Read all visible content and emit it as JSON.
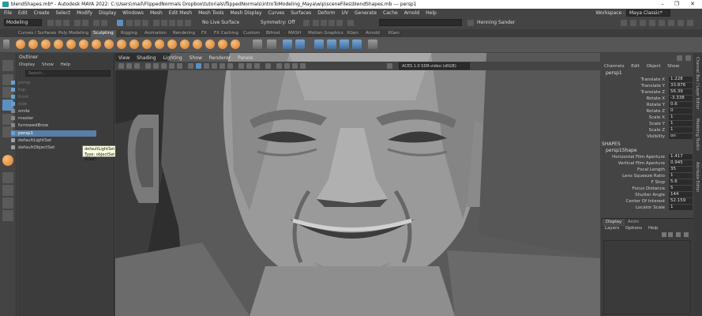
{
  "window": {
    "title": "blendShapes.mb* - Autodesk MAYA 2022: C:\\Users\\mail\\FlippedNormals Dropbox\\tutorials\\flippedNormals\\introToModeling_Maya\\wip\\sceneFiles\\blendShapes.mb  ---  persp1",
    "min": "–",
    "max": "❐",
    "close": "✕"
  },
  "menubar": {
    "items": [
      "File",
      "Edit",
      "Create",
      "Select",
      "Modify",
      "Display",
      "Windows",
      "Mesh",
      "Edit Mesh",
      "Mesh Tools",
      "Mesh Display",
      "Curves",
      "Surfaces",
      "Deform",
      "UV",
      "Generate",
      "Cache",
      "Arnold",
      "Help"
    ],
    "workspace_label": "Workspace :",
    "workspace_value": "Maya Classic*"
  },
  "statusline": {
    "mode": "Modeling",
    "live_surface": "No Live Surface",
    "symmetry": "Symmetry: Off",
    "user": "Henning Sander"
  },
  "shelf": {
    "tabs": [
      "Curves / Surfaces",
      "Poly Modeling",
      "Sculpting",
      "Rigging",
      "Animation",
      "Rendering",
      "FX",
      "FX Caching",
      "Custom",
      "Bifrost",
      "MASH",
      "Motion Graphics",
      "XGen",
      "Arnold",
      "XGen"
    ],
    "active_tab": "Sculpting"
  },
  "outliner": {
    "title": "Outliner",
    "menu": [
      "Display",
      "Show",
      "Help"
    ],
    "search_placeholder": "Search...",
    "items": [
      {
        "label": "persp",
        "dim": true
      },
      {
        "label": "top",
        "dim": true
      },
      {
        "label": "front",
        "dim": true
      },
      {
        "label": "side",
        "dim": true
      },
      {
        "label": "smile",
        "dim": false
      },
      {
        "label": "master",
        "dim": false
      },
      {
        "label": "furrowedBrow",
        "dim": false
      },
      {
        "label": "persp1",
        "dim": false,
        "selected": true
      },
      {
        "label": "defaultLightSet",
        "dim": false
      },
      {
        "label": "defaultObjectSet",
        "dim": false
      }
    ],
    "tooltip_line1": "defaultLightSet",
    "tooltip_line2": "Type: objectSet (kSet)"
  },
  "viewport": {
    "menu": [
      "View",
      "Shading",
      "Lighting",
      "Show",
      "Renderer",
      "Panels"
    ],
    "colorspace": "ACES 1.0 SDR-video (sRGB)"
  },
  "channelbox": {
    "menu": [
      "Channels",
      "Edit",
      "Object",
      "Show"
    ],
    "object": "persp1",
    "attrs": [
      {
        "label": "Translate X",
        "value": "1.228"
      },
      {
        "label": "Translate Y",
        "value": "33.876"
      },
      {
        "label": "Translate Z",
        "value": "56.39"
      },
      {
        "label": "Rotate X",
        "value": "-3.338"
      },
      {
        "label": "Rotate Y",
        "value": "0.6"
      },
      {
        "label": "Rotate Z",
        "value": "0"
      },
      {
        "label": "Scale X",
        "value": "1"
      },
      {
        "label": "Scale Y",
        "value": "1"
      },
      {
        "label": "Scale Z",
        "value": "1"
      },
      {
        "label": "Visibility",
        "value": "on"
      }
    ],
    "shapes_label": "SHAPES",
    "shape_name": "persp1Shape",
    "shape_attrs": [
      {
        "label": "Horizontal Film Aperture",
        "value": "1.417"
      },
      {
        "label": "Vertical Film Aperture",
        "value": "0.945"
      },
      {
        "label": "Focal Length",
        "value": "35"
      },
      {
        "label": "Lens Squeeze Ratio",
        "value": "1"
      },
      {
        "label": "F Stop",
        "value": "5.6"
      },
      {
        "label": "Focus Distance",
        "value": "5"
      },
      {
        "label": "Shutter Angle",
        "value": "144"
      },
      {
        "label": "Center Of Interest",
        "value": "52.159"
      },
      {
        "label": "Locator Scale",
        "value": "1"
      }
    ]
  },
  "layers": {
    "tabs": [
      "Display",
      "Anim"
    ],
    "menu": [
      "Layers",
      "Options",
      "Help"
    ]
  },
  "vtabs": [
    "Channel Box / Layer Editor",
    "Modeling Toolkit",
    "Attribute Editor"
  ]
}
